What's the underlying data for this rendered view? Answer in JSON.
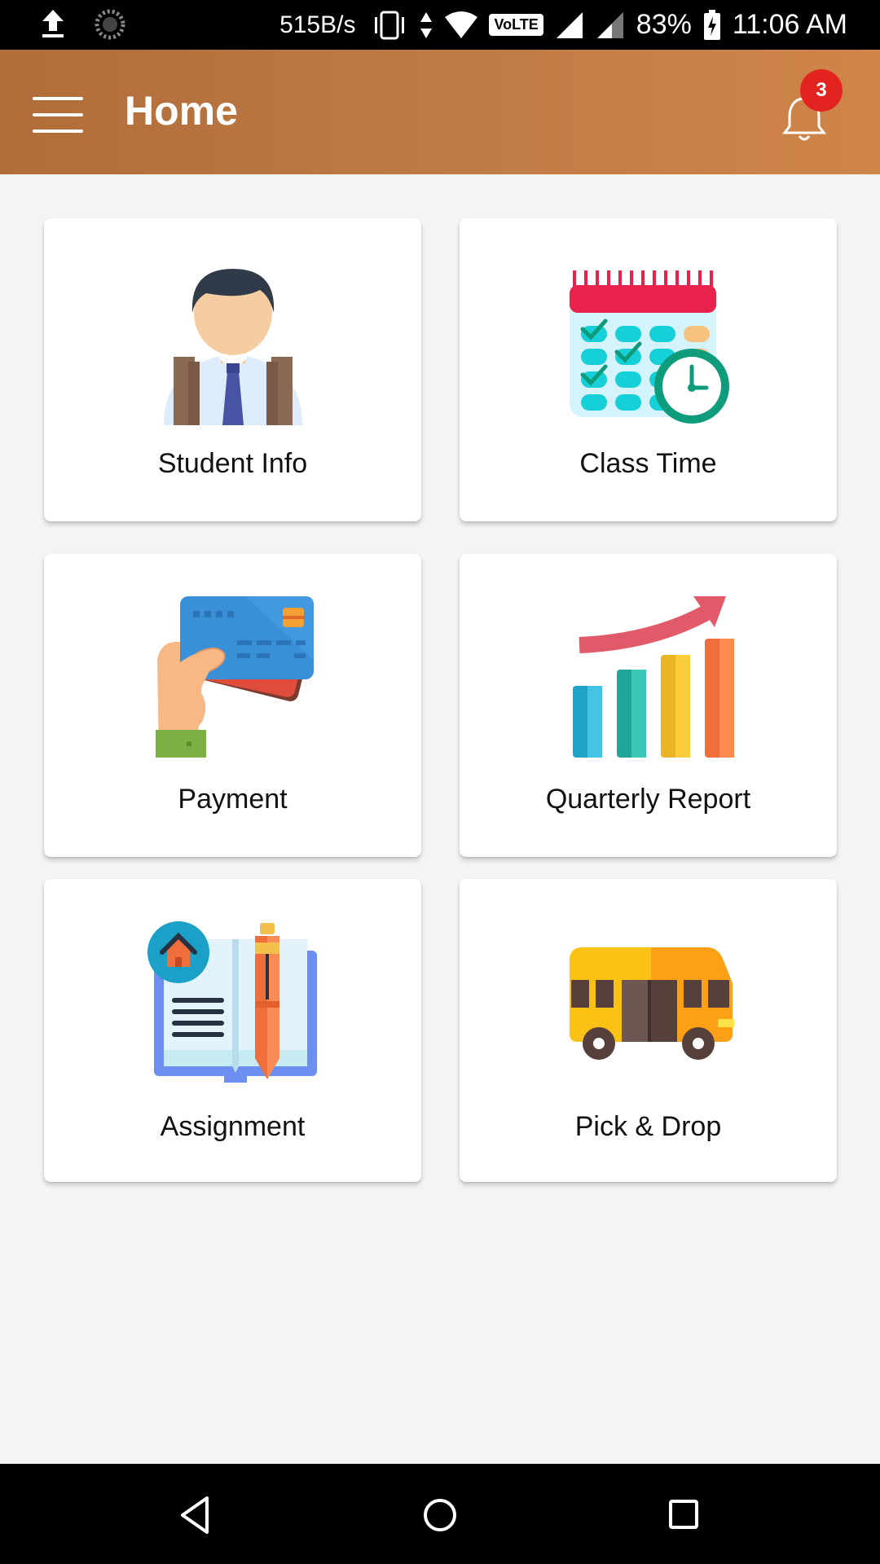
{
  "status_bar": {
    "speed": "515B/s",
    "volte": "VoLTE",
    "battery": "83%",
    "time": "11:06 AM",
    "icons": [
      "upload-icon",
      "sync-icon",
      "vibrate-icon",
      "data-arrows-icon",
      "wifi-icon",
      "volte-icon",
      "signal-icon",
      "signal-icon",
      "battery-charging-icon"
    ]
  },
  "app_bar": {
    "title": "Home",
    "notification_count": "3",
    "gradient": [
      "#b06d3a",
      "#d08549"
    ]
  },
  "tiles": [
    {
      "label": "Student Info",
      "icon": "student-icon"
    },
    {
      "label": "Class Time",
      "icon": "calendar-clock-icon"
    },
    {
      "label": "Payment",
      "icon": "credit-card-icon"
    },
    {
      "label": "Quarterly Report",
      "icon": "bar-chart-icon"
    },
    {
      "label": "Assignment",
      "icon": "homework-book-icon"
    },
    {
      "label": "Pick & Drop",
      "icon": "bus-icon"
    }
  ],
  "nav_bar": {
    "icons": [
      "back-icon",
      "home-icon",
      "recents-icon"
    ]
  },
  "colors": {
    "badge": "#e32320",
    "background": "#f4f4f4"
  }
}
